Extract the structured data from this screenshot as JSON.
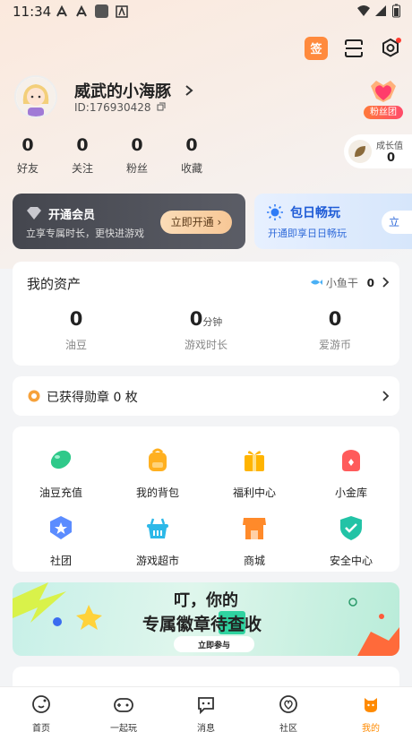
{
  "status_bar": {
    "time": "11:34"
  },
  "profile": {
    "nickname": "威武的小海豚",
    "uid": "ID:176930428",
    "fan_badge_label": "粉丝团",
    "check_in_label": "签"
  },
  "stats": [
    {
      "num": "0",
      "label": "好友"
    },
    {
      "num": "0",
      "label": "关注"
    },
    {
      "num": "0",
      "label": "粉丝"
    },
    {
      "num": "0",
      "label": "收藏"
    }
  ],
  "growth": {
    "label": "成长值",
    "value": "0"
  },
  "vip": {
    "title": "开通会员",
    "subtitle": "立享专属时长，更快进游戏",
    "button": "立即开通"
  },
  "day_pass": {
    "title": "包日畅玩",
    "subtitle": "开通即享日日畅玩",
    "button": "立"
  },
  "assets": {
    "title": "我的资产",
    "fish_label": "小鱼干",
    "fish_value": "0",
    "items": [
      {
        "num": "0",
        "unit": "",
        "label": "油豆"
      },
      {
        "num": "0",
        "unit": "分钟",
        "label": "游戏时长"
      },
      {
        "num": "0",
        "unit": "",
        "label": "爱游币"
      }
    ]
  },
  "medal": {
    "text": "已获得勋章 0 枚"
  },
  "grid": [
    {
      "label": "油豆充值",
      "icon": "bean-icon",
      "color": "#2fc98a"
    },
    {
      "label": "我的背包",
      "icon": "backpack-icon",
      "color": "#ffb020"
    },
    {
      "label": "福利中心",
      "icon": "gift-icon",
      "color": "#ffb400"
    },
    {
      "label": "小金库",
      "icon": "wallet-icon",
      "color": "#ff5b5b"
    },
    {
      "label": "社团",
      "icon": "club-icon",
      "color": "#5b8cff"
    },
    {
      "label": "游戏超市",
      "icon": "basket-icon",
      "color": "#2cb8e8"
    },
    {
      "label": "商城",
      "icon": "shop-icon",
      "color": "#ff8a2a"
    },
    {
      "label": "安全中心",
      "icon": "shield-icon",
      "color": "#22c3a6"
    }
  ],
  "banner": {
    "line1": "叮，你的",
    "line2": "专属徽章待查收",
    "button": "立即参与"
  },
  "tabs": [
    {
      "label": "首页",
      "icon": "home-icon"
    },
    {
      "label": "一起玩",
      "icon": "gamepad-icon"
    },
    {
      "label": "消息",
      "icon": "message-icon"
    },
    {
      "label": "社区",
      "icon": "community-icon"
    },
    {
      "label": "我的",
      "icon": "profile-icon",
      "active": true
    }
  ]
}
